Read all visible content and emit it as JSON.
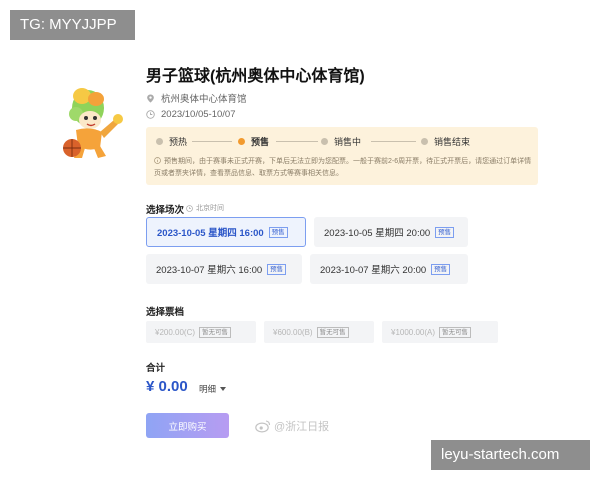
{
  "tags": {
    "top_left": "TG: MYYJJPP",
    "bottom_right": "leyu-startech.com"
  },
  "event": {
    "title": "男子篮球(杭州奥体中心体育馆)",
    "venue": "杭州奥体中心体育馆",
    "date_range": "2023/10/05-10/07"
  },
  "status": {
    "steps": [
      {
        "label": "预热",
        "active": false
      },
      {
        "label": "预售",
        "active": true
      },
      {
        "label": "销售中",
        "active": false
      },
      {
        "label": "销售结束",
        "active": false
      }
    ],
    "notice": "预售期间，由于赛事未正式开赛，下单后无法立即为您配票。一般于赛前2-6周开票，待正式开票后，请您通过订单详情页或者票夹详情，查看票品信息、取票方式等赛事相关信息。"
  },
  "session": {
    "label": "选择场次",
    "timezone": "北京时间",
    "items": [
      {
        "text": "2023-10-05 星期四 16:00",
        "badge": "预售",
        "selected": true
      },
      {
        "text": "2023-10-05 星期四 20:00",
        "badge": "预售",
        "selected": false
      },
      {
        "text": "2023-10-07 星期六 16:00",
        "badge": "预售",
        "selected": false
      },
      {
        "text": "2023-10-07 星期六 20:00",
        "badge": "预售",
        "selected": false
      }
    ]
  },
  "tier": {
    "label": "选择票档",
    "items": [
      {
        "price": "¥200.00(C)",
        "badge": "暂无可售"
      },
      {
        "price": "¥600.00(B)",
        "badge": "暂无可售"
      },
      {
        "price": "¥1000.00(A)",
        "badge": "暂无可售"
      }
    ]
  },
  "total": {
    "label": "合计",
    "amount": "¥ 0.00",
    "detail_label": "明细"
  },
  "buy_label": "立即购买",
  "watermark": "@浙江日报",
  "colors": {
    "accent": "#2b56c8",
    "status_bg": "#fdf2dc",
    "active_dot": "#f29a2e"
  }
}
